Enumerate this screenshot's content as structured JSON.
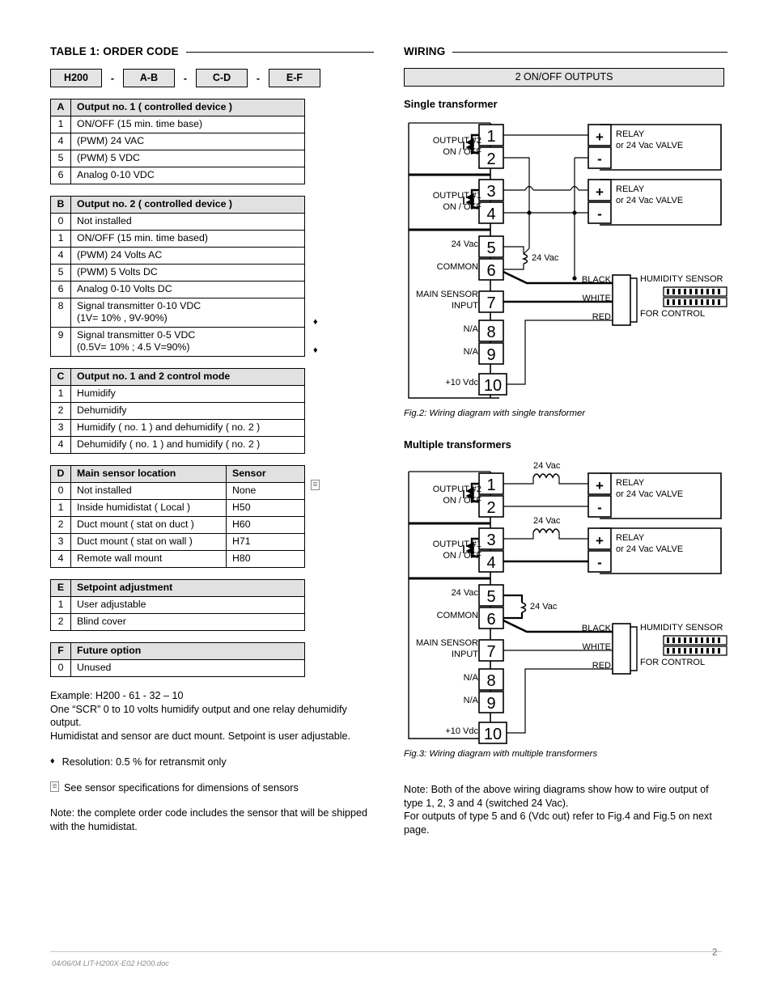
{
  "left": {
    "section_title": "TABLE 1: ORDER CODE",
    "order_code": {
      "parts": [
        "H200",
        "A-B",
        "C-D",
        "E-F"
      ],
      "separator": "-"
    },
    "tables": [
      {
        "key": "A",
        "header": "Output no. 1 ( controlled device )",
        "rows": [
          {
            "code": "1",
            "desc": "ON/OFF (15 min. time base)"
          },
          {
            "code": "4",
            "desc": "(PWM) 24 VAC"
          },
          {
            "code": "5",
            "desc": "(PWM) 5 VDC"
          },
          {
            "code": "6",
            "desc": "Analog 0-10 VDC"
          }
        ]
      },
      {
        "key": "B",
        "header": "Output no. 2 ( controlled device )",
        "rows": [
          {
            "code": "0",
            "desc": "Not installed"
          },
          {
            "code": "1",
            "desc": "ON/OFF (15 min. time based)"
          },
          {
            "code": "4",
            "desc": "(PWM) 24 Volts AC"
          },
          {
            "code": "5",
            "desc": "(PWM) 5 Volts DC"
          },
          {
            "code": "6",
            "desc": "Analog 0-10 Volts DC"
          },
          {
            "code": "8",
            "desc": "Signal transmitter 0-10 VDC\n(1V= 10% , 9V-90%)",
            "marker": "♦"
          },
          {
            "code": "9",
            "desc": "Signal transmitter 0-5 VDC\n(0.5V= 10% ; 4.5 V=90%)",
            "marker": "♦"
          }
        ]
      },
      {
        "key": "C",
        "header": "Output no. 1 and 2 control mode",
        "rows": [
          {
            "code": "1",
            "desc": "Humidify"
          },
          {
            "code": "2",
            "desc": "Dehumidify"
          },
          {
            "code": "3",
            "desc": "Humidify ( no. 1 ) and dehumidify ( no. 2 )"
          },
          {
            "code": "4",
            "desc": "Dehumidify ( no. 1 ) and humidify ( no. 2 )"
          }
        ]
      },
      {
        "key": "D",
        "header": "Main sensor location",
        "header2": "Sensor",
        "header_marker": "book-icon",
        "rows": [
          {
            "code": "0",
            "desc": "Not installed",
            "sensor": "None"
          },
          {
            "code": "1",
            "desc": "Inside humidistat ( Local )",
            "sensor": "H50"
          },
          {
            "code": "2",
            "desc": "Duct mount ( stat on duct )",
            "sensor": "H60"
          },
          {
            "code": "3",
            "desc": "Duct mount ( stat on wall )",
            "sensor": "H71"
          },
          {
            "code": "4",
            "desc": "Remote wall mount",
            "sensor": "H80"
          }
        ]
      },
      {
        "key": "E",
        "header": "Setpoint adjustment",
        "rows": [
          {
            "code": "1",
            "desc": "User adjustable"
          },
          {
            "code": "2",
            "desc": "Blind cover"
          }
        ]
      },
      {
        "key": "F",
        "header": "Future option",
        "rows": [
          {
            "code": "0",
            "desc": "Unused"
          }
        ]
      }
    ],
    "example_text": "Example:  H200 - 61 - 32 – 10\nOne “SCR” 0 to 10 volts humidify output and one relay dehumidify output.\nHumidistat and sensor are duct mount. Setpoint is user adjustable.",
    "resolution_bullet": {
      "marker": "♦",
      "text": "Resolution:  0.5 %  for retransmit only"
    },
    "sensor_spec_note": {
      "marker": "book-icon",
      "text": "See sensor specifications for dimensions of sensors"
    },
    "order_note": "Note: the complete  order code includes the sensor that will be shipped with the humidistat."
  },
  "right": {
    "section_title": "WIRING",
    "banner": "2 ON/OFF OUTPUTS",
    "fig2": {
      "subhead": "Single transformer",
      "caption": "Fig.2: Wiring diagram with single transformer",
      "terminals": [
        {
          "n": "1",
          "label": ""
        },
        {
          "n": "2",
          "label": ""
        },
        {
          "n": "3",
          "label": ""
        },
        {
          "n": "4",
          "label": ""
        },
        {
          "n": "5",
          "label": "24 Vac"
        },
        {
          "n": "6",
          "label": "COMMON"
        },
        {
          "n": "7",
          "label": "MAIN SENSOR\nINPUT"
        },
        {
          "n": "8",
          "label": "N/A"
        },
        {
          "n": "9",
          "label": "N/A"
        },
        {
          "n": "10",
          "label": "+10 Vdc"
        }
      ],
      "output2_label": "OUTPUT #2\nON / OFF",
      "output1_label": "OUTPUT #1\nON / OFF",
      "transformer_label": "24 Vac",
      "relay1": "RELAY\nor 24 Vac VALVE",
      "relay2": "RELAY\nor 24 Vac VALVE",
      "plus": "+",
      "minus": "-",
      "wire_black": "BLACK",
      "wire_white": "WHITE",
      "wire_red": "RED",
      "sensor_top": "HUMIDITY SENSOR",
      "sensor_bottom": "FOR CONTROL"
    },
    "fig3": {
      "subhead": "Multiple transformers",
      "caption": "Fig.3: Wiring diagram with multiple transformers",
      "terminals": [
        {
          "n": "1",
          "label": ""
        },
        {
          "n": "2",
          "label": ""
        },
        {
          "n": "3",
          "label": ""
        },
        {
          "n": "4",
          "label": ""
        },
        {
          "n": "5",
          "label": "24 Vac"
        },
        {
          "n": "6",
          "label": "COMMON"
        },
        {
          "n": "7",
          "label": "MAIN SENSOR\nINPUT"
        },
        {
          "n": "8",
          "label": "N/A"
        },
        {
          "n": "9",
          "label": "N/A"
        },
        {
          "n": "10",
          "label": "+10 Vdc"
        }
      ],
      "output2_label": "OUTPUT #2\nON / OFF",
      "output1_label": "OUTPUT #1\nON / OFF",
      "transformer_label_1": "24 Vac",
      "transformer_label_2": "24 Vac",
      "transformer_label_3": "24 Vac",
      "relay1": "RELAY\nor 24 Vac VALVE",
      "relay2": "RELAY\nor 24 Vac VALVE",
      "plus": "+",
      "minus": "-",
      "wire_black": "BLACK",
      "wire_white": "WHITE",
      "wire_red": "RED",
      "sensor_top": "HUMIDITY SENSOR",
      "sensor_bottom": "FOR CONTROL"
    },
    "bottom_note": "Note:  Both of the above wiring diagrams show how to wire output of type 1, 2, 3 and 4 (switched 24 Vac).\nFor outputs of type 5 and 6 (Vdc out) refer to Fig.4 and Fig.5 on next page."
  },
  "footer": {
    "text": "04/06/04  LIT-H200X-E02 H200.doc",
    "page": "2"
  }
}
